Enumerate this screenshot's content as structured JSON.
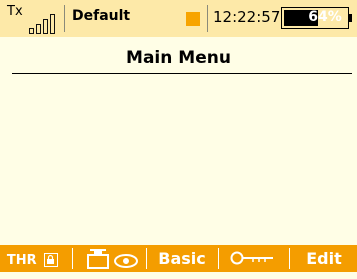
{
  "status_bar": {
    "tx_label": "Tx",
    "model_name": "Default",
    "time": "12:22:57",
    "battery_percent": "64%"
  },
  "main": {
    "title": "Main Menu"
  },
  "bottom_bar": {
    "thr_label": "THR",
    "basic_label": "Basic",
    "edit_label": "Edit"
  },
  "colors": {
    "status_bar_bg": "#fde9a8",
    "body_bg": "#fffee6",
    "bottom_bar_bg": "#f49d00",
    "indicator_orange": "#f7a400"
  },
  "icons": [
    "signal-strength-icon",
    "padlock-icon",
    "servo-eye-icon",
    "key-icon"
  ]
}
